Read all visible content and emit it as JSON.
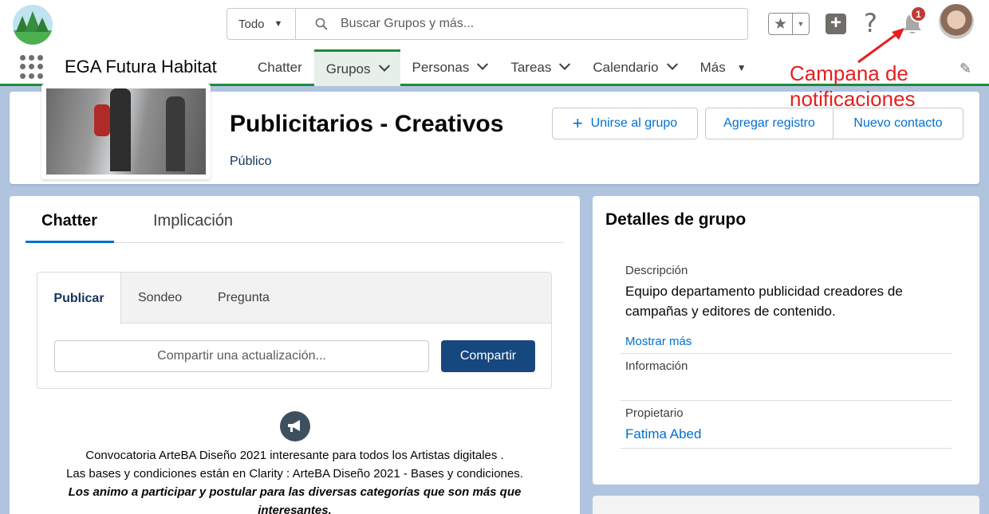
{
  "header": {
    "search_scope": "Todo",
    "search_placeholder": "Buscar Grupos y más...",
    "notification_count": "1",
    "icons": [
      "star-icon",
      "plus-icon",
      "help-icon",
      "bell-icon"
    ]
  },
  "nav": {
    "app_name": "EGA Futura Habitat",
    "items": [
      {
        "label": "Chatter",
        "dropdown": false
      },
      {
        "label": "Grupos",
        "dropdown": true,
        "active": true
      },
      {
        "label": "Personas",
        "dropdown": true
      },
      {
        "label": "Tareas",
        "dropdown": true
      },
      {
        "label": "Calendario",
        "dropdown": true
      },
      {
        "label": "Más",
        "dropdown": true
      }
    ]
  },
  "annotation": {
    "line1": "Campana de",
    "line2": "notificaciones",
    "color": "#e51f1f"
  },
  "group": {
    "title": "Publicitarios - Creativos",
    "visibility": "Público",
    "join_label": "Unirse al grupo",
    "add_record_label": "Agregar registro",
    "new_contact_label": "Nuevo contacto"
  },
  "feed": {
    "tabs": [
      "Chatter",
      "Implicación"
    ],
    "publisher_tabs": [
      "Publicar",
      "Sondeo",
      "Pregunta"
    ],
    "input_placeholder": "Compartir una actualización...",
    "share_label": "Compartir",
    "post": {
      "line1": "Convocatoria ArteBA Diseño 2021 interesante para todos los Artistas digitales .",
      "line2": "Las bases y condiciones están en Clarity : ArteBA Diseño 2021 - Bases y condiciones.",
      "line3": "Los animo a participar y postular para las diversas categorías que son más que",
      "line4": "interesantes."
    }
  },
  "details": {
    "title": "Detalles de grupo",
    "description_label": "Descripción",
    "description_line1": "Equipo departamento publicidad creadores de",
    "description_line2": "campañas y editores de contenido.",
    "show_more": "Mostrar más",
    "info_label": "Información",
    "owner_label": "Propietario",
    "owner_name": "Fatima Abed"
  },
  "colors": {
    "accent_green": "#1e8a3c",
    "link_blue": "#0070d2",
    "brand_button": "#16477f",
    "badge_red": "#c23934"
  }
}
